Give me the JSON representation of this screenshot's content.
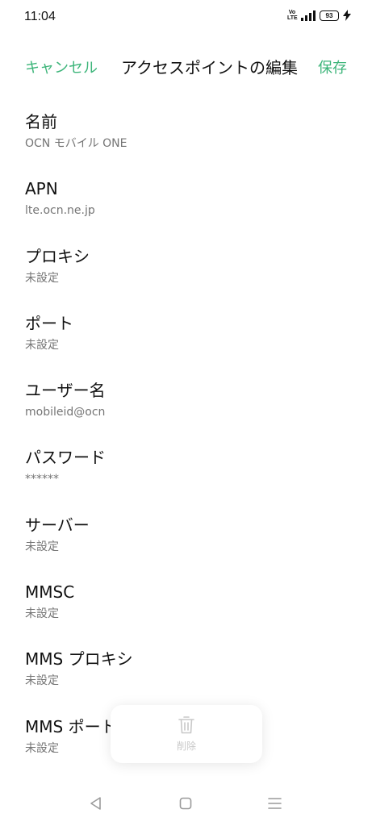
{
  "status_bar": {
    "time": "11:04",
    "volte_top": "Vo",
    "volte_bottom": "LTE",
    "battery": "93"
  },
  "header": {
    "cancel_label": "キャンセル",
    "title": "アクセスポイントの編集",
    "save_label": "保存"
  },
  "items": [
    {
      "title": "名前",
      "value": "OCN モバイル ONE"
    },
    {
      "title": "APN",
      "value": "lte.ocn.ne.jp"
    },
    {
      "title": "プロキシ",
      "value": "未設定"
    },
    {
      "title": "ポート",
      "value": "未設定"
    },
    {
      "title": "ユーザー名",
      "value": "mobileid@ocn"
    },
    {
      "title": "パスワード",
      "value": "******"
    },
    {
      "title": "サーバー",
      "value": "未設定"
    },
    {
      "title": "MMSC",
      "value": "未設定"
    },
    {
      "title": "MMS プロキシ",
      "value": "未設定"
    },
    {
      "title": "MMS ポート",
      "value": "未設定"
    }
  ],
  "delete_panel": {
    "icon": "trash-icon",
    "label": "削除"
  },
  "colors": {
    "accent": "#3db57a",
    "secondary_text": "#757575",
    "disabled": "#c8c8c8"
  },
  "nav": {
    "back_icon": "back-triangle-icon",
    "home_icon": "home-square-icon",
    "menu_icon": "menu-lines-icon"
  }
}
